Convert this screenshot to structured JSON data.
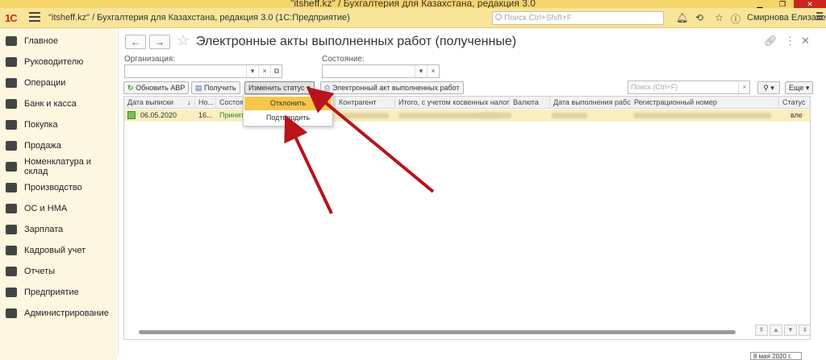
{
  "window": {
    "title": "\"itsheff.kz\" / Бухгалтерия для Казахстана, редакция 3.0"
  },
  "app": {
    "logo_text": "1С",
    "title": "\"itsheff.kz\" / Бухгалтерия для Казахстана, редакция 3.0  (1С:Предприятие)",
    "search_placeholder": "Поиск Ctrl+Shift+F",
    "user": "Смирнова Елизавета"
  },
  "sidebar": {
    "items": [
      {
        "label": "Главное",
        "icon": "list-icon"
      },
      {
        "label": "Руководителю",
        "icon": "chart-line-icon"
      },
      {
        "label": "Операции",
        "icon": "operations-icon"
      },
      {
        "label": "Банк и касса",
        "icon": "coins-icon"
      },
      {
        "label": "Покупка",
        "icon": "cart-icon"
      },
      {
        "label": "Продажа",
        "icon": "bag-icon"
      },
      {
        "label": "Номенклатура и склад",
        "icon": "grid-icon"
      },
      {
        "label": "Производство",
        "icon": "factory-icon"
      },
      {
        "label": "ОС и НМА",
        "icon": "truck-icon"
      },
      {
        "label": "Зарплата",
        "icon": "money-icon"
      },
      {
        "label": "Кадровый учет",
        "icon": "people-icon"
      },
      {
        "label": "Отчеты",
        "icon": "bar-chart-icon"
      },
      {
        "label": "Предприятие",
        "icon": "building-icon"
      },
      {
        "label": "Администрирование",
        "icon": "gear-icon"
      }
    ]
  },
  "form": {
    "title": "Электронные акты выполненных работ (полученные)",
    "org_label": "Организация:",
    "state_label": "Состояние:",
    "buttons": {
      "refresh": "Обновить АВР",
      "receive": "Получить",
      "change_status": "Изменить статус",
      "print": "Электронный акт выполненных работ",
      "more": "Еще"
    },
    "table_search_placeholder": "Поиск (Ctrl+F)"
  },
  "table": {
    "columns": [
      "Дата выписки",
      "Но...",
      "Состоя...",
      "Контрагент",
      "Итого, с учетом косвенных налогов",
      "Валюта",
      "Дата выполнения работ",
      "Регистрационный номер",
      "Статус"
    ],
    "rows": [
      {
        "date": "06.05.2020",
        "number": "16...",
        "state": "Принят",
        "status_tail": "вле"
      }
    ]
  },
  "dropdown": {
    "items": [
      "Отклонить",
      "Подтвердить"
    ]
  },
  "tooltip": "8 мая 2020 г."
}
